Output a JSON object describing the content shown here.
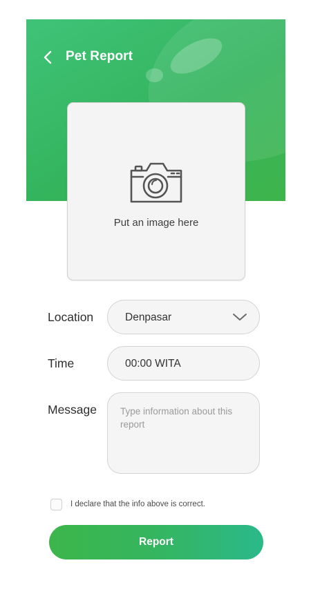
{
  "header": {
    "title": "Pet Report",
    "back_icon": "chevron-left-icon",
    "colors": {
      "start": "#3fc378",
      "end": "#3fb44b"
    }
  },
  "upload": {
    "icon": "camera-icon",
    "text": "Put an image here"
  },
  "form": {
    "location": {
      "label": "Location",
      "value": "Denpasar",
      "icon": "chevron-down-icon"
    },
    "time": {
      "label": "Time",
      "value": "00:00 WITA"
    },
    "message": {
      "label": "Message",
      "value": "",
      "placeholder": "Type information about this report"
    }
  },
  "declaration": {
    "checked": false,
    "text": "I declare that the info above is correct."
  },
  "submit": {
    "label": "Report",
    "colors": {
      "start": "#3cb64b",
      "end": "#2bb98a"
    }
  }
}
